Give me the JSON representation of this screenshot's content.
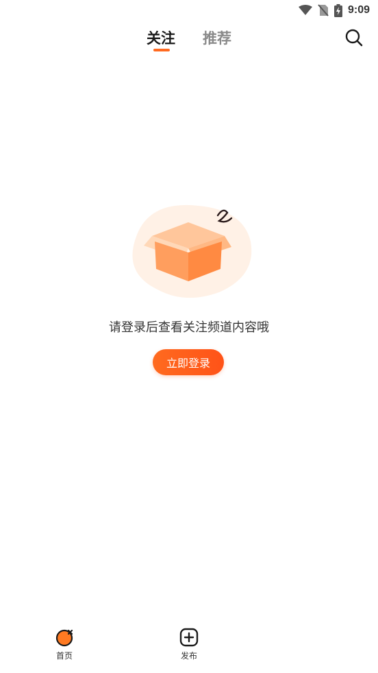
{
  "status_bar": {
    "time": "9:09",
    "icons": [
      "wifi-icon",
      "no-sim-icon",
      "battery-charging-icon"
    ]
  },
  "top_tabs": {
    "items": [
      {
        "label": "关注",
        "active": true
      },
      {
        "label": "推荐",
        "active": false
      }
    ],
    "search_icon": "search-icon"
  },
  "empty_state": {
    "illustration": "empty-box-icon",
    "message": "请登录后查看关注频道内容哦",
    "login_button": "立即登录"
  },
  "bottom_nav": {
    "items": [
      {
        "label": "首页",
        "icon": "home-icon"
      },
      {
        "label": "发布",
        "icon": "publish-plus-icon"
      }
    ]
  },
  "colors": {
    "accent": "#ff6a21",
    "text_primary": "#1a1a1a",
    "text_secondary": "#8a8a8a"
  }
}
